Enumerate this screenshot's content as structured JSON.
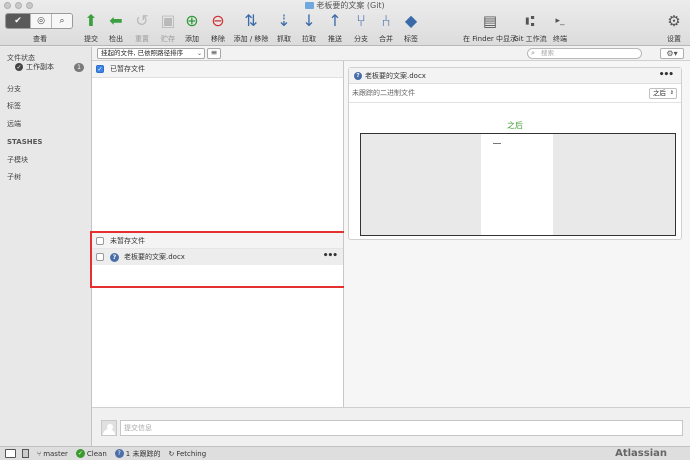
{
  "window": {
    "title": "老板要的文案 (Git)"
  },
  "toolbar": {
    "view_label": "查看",
    "buttons": [
      {
        "id": "commit",
        "label": "提交",
        "icon": "commit-icon",
        "color": "#3aa040",
        "enabled": true
      },
      {
        "id": "checkout",
        "label": "检出",
        "icon": "checkout-icon",
        "color": "#3aa040",
        "enabled": true
      },
      {
        "id": "reset",
        "label": "重置",
        "icon": "reset-icon",
        "color": "#888888",
        "enabled": false
      },
      {
        "id": "stash",
        "label": "贮存",
        "icon": "stash-icon",
        "color": "#888888",
        "enabled": false
      },
      {
        "id": "add",
        "label": "添加",
        "icon": "add-icon",
        "color": "#2e9a3a",
        "enabled": true
      },
      {
        "id": "remove",
        "label": "移除",
        "icon": "remove-icon",
        "color": "#d03030",
        "enabled": true
      },
      {
        "id": "add-remove",
        "label": "添加 / 移除",
        "icon": "add-remove-icon",
        "color": "#3a6aa8",
        "enabled": true
      },
      {
        "id": "fetch",
        "label": "抓取",
        "icon": "fetch-icon",
        "color": "#3a6aa8",
        "enabled": true
      },
      {
        "id": "pull",
        "label": "拉取",
        "icon": "pull-icon",
        "color": "#3a6aa8",
        "enabled": true
      },
      {
        "id": "push",
        "label": "推送",
        "icon": "push-icon",
        "color": "#3a6aa8",
        "enabled": true
      },
      {
        "id": "branch",
        "label": "分支",
        "icon": "branch-icon",
        "color": "#3a6aa8",
        "enabled": true
      },
      {
        "id": "merge",
        "label": "合并",
        "icon": "merge-icon",
        "color": "#3a6aa8",
        "enabled": true
      },
      {
        "id": "tag",
        "label": "标签",
        "icon": "tag-icon",
        "color": "#3a6aa8",
        "enabled": true
      }
    ],
    "right_buttons": [
      {
        "id": "finder",
        "label": "在 Finder 中显示",
        "icon": "finder-icon"
      },
      {
        "id": "git-flow",
        "label": "Git 工作流",
        "icon": "git-flow-icon"
      },
      {
        "id": "terminal",
        "label": "终端",
        "icon": "terminal-icon"
      },
      {
        "id": "settings",
        "label": "设置",
        "icon": "gear-icon"
      }
    ]
  },
  "sidebar": {
    "file_status": "文件状态",
    "working_copy": {
      "label": "工作副本",
      "badge": "1"
    },
    "branches": "分支",
    "tags": "标签",
    "remotes": "远端",
    "stashes": "STASHES",
    "submodules": "子模块",
    "subtrees": "子树"
  },
  "filter": {
    "value": "挂起的文件, 已依照路径排序"
  },
  "search": {
    "placeholder": "搜索"
  },
  "staged": {
    "label": "已暂存文件",
    "checked": true
  },
  "unstaged": {
    "label": "未暂存文件",
    "checked": false
  },
  "files": [
    {
      "name": "老板要的文案.docx",
      "status": "untracked"
    }
  ],
  "diff": {
    "file": "老板要的文案.docx",
    "description": "未跟踪的二进制文件",
    "view_select": "之后",
    "after_label": "之后"
  },
  "commit": {
    "placeholder": "提交信息"
  },
  "status": {
    "branch": "master",
    "clean": "Clean",
    "untracked": "1 未跟踪的",
    "fetching": "Fetching",
    "brand": "Atlassian"
  }
}
